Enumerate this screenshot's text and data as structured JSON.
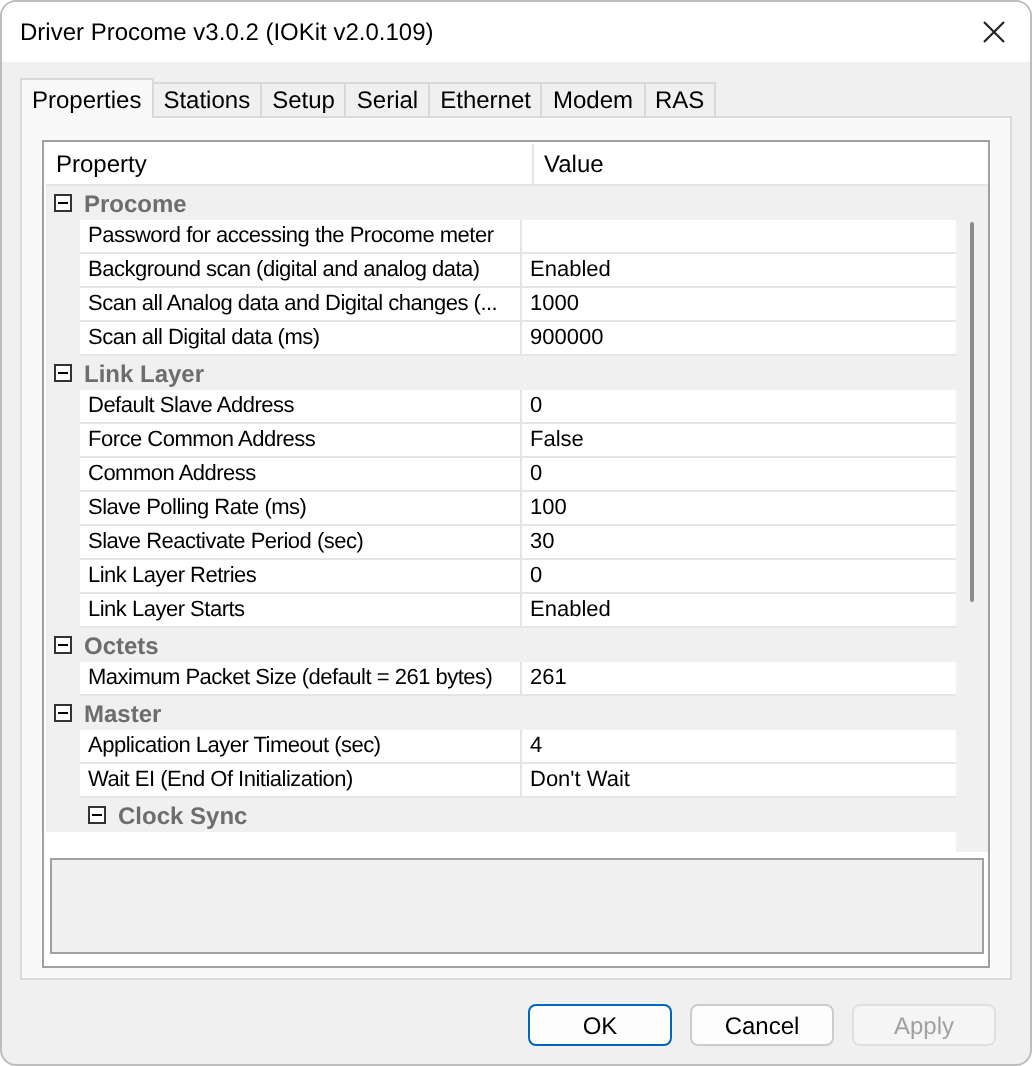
{
  "window": {
    "title": "Driver Procome v3.0.2 (IOKit v2.0.109)"
  },
  "tabs": [
    {
      "label": "Properties",
      "selected": true
    },
    {
      "label": "Stations",
      "selected": false
    },
    {
      "label": "Setup",
      "selected": false
    },
    {
      "label": "Serial",
      "selected": false
    },
    {
      "label": "Ethernet",
      "selected": false
    },
    {
      "label": "Modem",
      "selected": false
    },
    {
      "label": "RAS",
      "selected": false
    }
  ],
  "grid": {
    "columns": [
      "Property",
      "Value"
    ],
    "groups": [
      {
        "kind": "group",
        "name": "Procome",
        "expanded": true,
        "children": [
          {
            "kind": "property",
            "name": "Password for accessing the Procome meter"
          },
          {
            "kind": "property",
            "name": "Background scan (digital and analog data)",
            "value": "Enabled"
          },
          {
            "kind": "property",
            "name": "Scan all Analog data and Digital changes (...",
            "value": "1000"
          },
          {
            "kind": "property",
            "name": "Scan all Digital data (ms)",
            "value": "900000"
          }
        ]
      },
      {
        "kind": "group",
        "name": "Link Layer",
        "expanded": true,
        "children": [
          {
            "kind": "property",
            "name": "Default Slave Address",
            "value": "0"
          },
          {
            "kind": "property",
            "name": "Force Common Address",
            "value": "False"
          },
          {
            "kind": "property",
            "name": "Common Address",
            "value": "0"
          },
          {
            "kind": "property",
            "name": "Slave Polling Rate (ms)",
            "value": "100"
          },
          {
            "kind": "property",
            "name": "Slave Reactivate Period (sec)",
            "value": "30"
          },
          {
            "kind": "property",
            "name": "Link Layer Retries",
            "value": "0"
          },
          {
            "kind": "property",
            "name": "Link Layer Starts",
            "value": "Enabled"
          }
        ]
      },
      {
        "kind": "group",
        "name": "Octets",
        "expanded": true,
        "children": [
          {
            "kind": "property",
            "name": "Maximum Packet Size (default = 261 bytes)",
            "value": "261"
          }
        ]
      },
      {
        "kind": "group",
        "name": "Master",
        "expanded": true,
        "children": [
          {
            "kind": "property",
            "name": "Application Layer Timeout (sec)",
            "value": "4"
          },
          {
            "kind": "property",
            "name": "Wait EI (End Of Initialization)",
            "value": "Don't Wait"
          },
          {
            "kind": "group",
            "name": "Clock Sync",
            "expanded": true
          }
        ]
      }
    ]
  },
  "buttons": [
    {
      "label": "OK",
      "default": true,
      "disabled": false
    },
    {
      "label": "Cancel",
      "default": false,
      "disabled": false
    },
    {
      "label": "Apply",
      "default": false,
      "disabled": true
    }
  ]
}
